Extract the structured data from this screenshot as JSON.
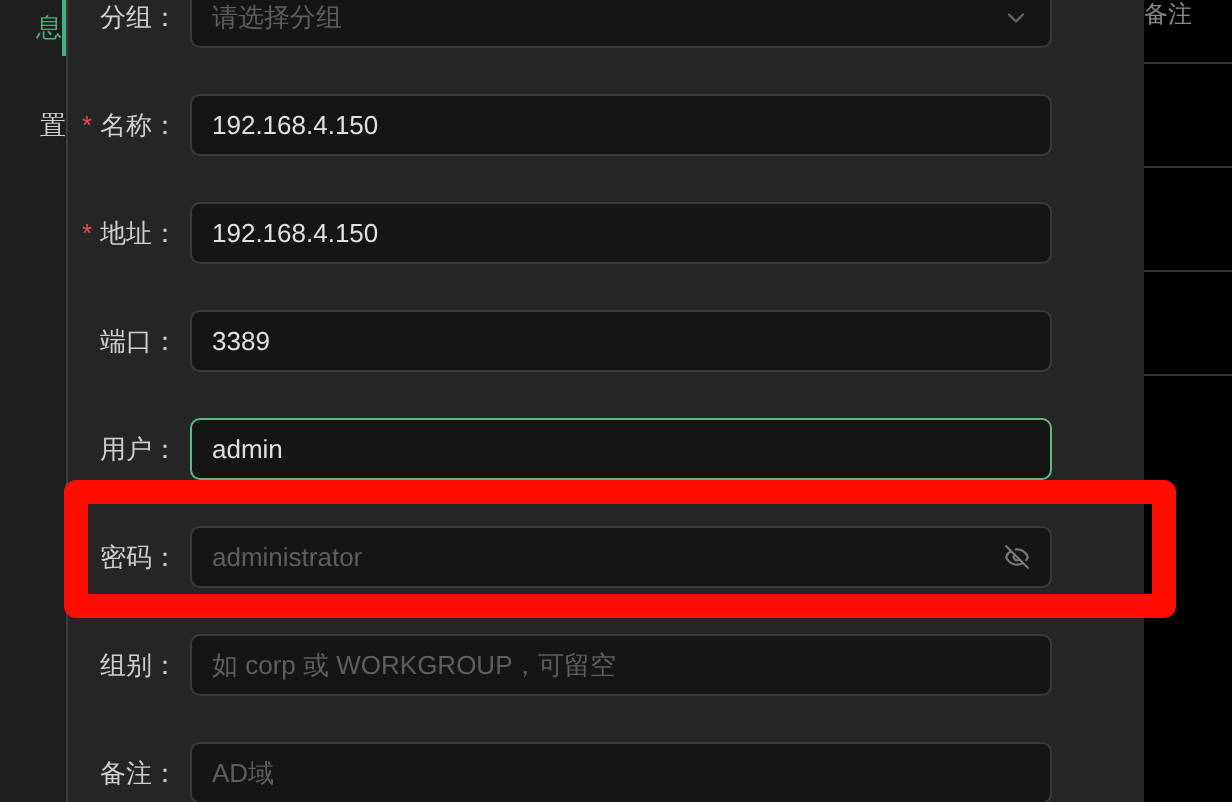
{
  "sidebar": {
    "items": [
      {
        "label": "息",
        "selected": true
      },
      {
        "label": "置",
        "selected": false
      }
    ]
  },
  "form": {
    "fields": [
      {
        "label": "分组：",
        "kind": "select",
        "placeholder": "请选择分组",
        "focused": false
      },
      {
        "label": "名称：",
        "kind": "text",
        "required_mark": "*",
        "value": "192.168.4.150",
        "focused": false
      },
      {
        "label": "地址：",
        "kind": "text",
        "required_mark": "*",
        "value": "192.168.4.150",
        "focused": false
      },
      {
        "label": "端口：",
        "kind": "text",
        "value": "3389",
        "focused": false
      },
      {
        "label": "用户：",
        "kind": "text",
        "value": "admin",
        "focused": true
      },
      {
        "label": "密码：",
        "kind": "password",
        "placeholder": "administrator",
        "focused": false,
        "highlighted": true
      },
      {
        "label": "组别：",
        "kind": "text",
        "placeholder": "如 corp 或 WORKGROUP，可留空",
        "focused": false
      },
      {
        "label": "备注：",
        "kind": "text",
        "placeholder": "AD域",
        "focused": false
      }
    ]
  },
  "table": {
    "columns": [
      "备注"
    ]
  }
}
